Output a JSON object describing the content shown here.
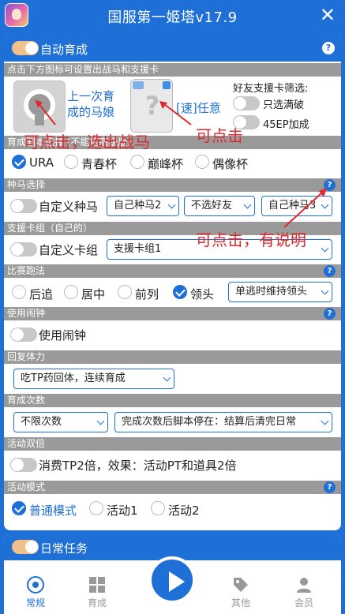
{
  "window": {
    "title": "国服第一姬塔v17.9"
  },
  "auto_train": {
    "label": "自动育成",
    "enabled": true,
    "hint_section": "点击下方图标可设置出战马和支援卡",
    "last_horse_label": "上一次育成的马娘",
    "support_label": "[速]任意",
    "friend_filter_title": "好友支援卡筛选:",
    "friend_options": [
      {
        "label": "只选满破",
        "on": false
      },
      {
        "label": "45EP加成",
        "on": false
      }
    ],
    "scenario_section": "育成剧本选择 (不能用高级版)",
    "scenarios": [
      {
        "label": "URA",
        "selected": true
      },
      {
        "label": "青春杯",
        "selected": false
      },
      {
        "label": "巅峰杯",
        "selected": false
      },
      {
        "label": "偶像杯",
        "selected": false
      }
    ],
    "breed_section": "种马选择",
    "breed_toggle_label": "自定义种马",
    "breed_selects": [
      "自己种马2",
      "不选好友",
      "自己种马3"
    ],
    "support_section": "支援卡组（自己的）",
    "support_toggle_label": "自定义卡组",
    "support_select": "支援卡组1",
    "race_section": "比赛跑法",
    "race_styles": [
      {
        "label": "后追",
        "selected": false
      },
      {
        "label": "居中",
        "selected": false
      },
      {
        "label": "前列",
        "selected": false
      },
      {
        "label": "领头",
        "selected": true
      }
    ],
    "race_select": "单逃时维持领头",
    "alarm_section": "使用闹钟",
    "alarm_label": "使用闹钟",
    "recover_section": "回复体力",
    "recover_select": "吃TP药回体，连续育成",
    "count_section": "育成次数",
    "count_select": "不限次数",
    "finish_select": "完成次数后脚本停在：结算后清完日常",
    "double_section": "活动双倍",
    "double_label": "消费TP2倍，效果：活动PT和道具2倍",
    "mode_section": "活动模式",
    "modes": [
      {
        "label": "普通模式",
        "selected": true
      },
      {
        "label": "活动1",
        "selected": false
      },
      {
        "label": "活动2",
        "selected": false
      }
    ]
  },
  "daily": {
    "label": "日常任务",
    "enabled": true
  },
  "annotations": {
    "select_horse": "可点击，选出战马",
    "clickable": "可点击",
    "clickable_desc": "可点击，有说明"
  },
  "nav": {
    "items": [
      {
        "label": "常规",
        "icon": "chrome-like-icon",
        "active": true
      },
      {
        "label": "育成",
        "icon": "grid-icon",
        "active": false
      },
      {
        "label": "其他",
        "icon": "tag-icon",
        "active": false
      },
      {
        "label": "会员",
        "icon": "user-icon",
        "active": false
      }
    ],
    "play_icon": "play-icon"
  },
  "colors": {
    "primary": "#1e6fd6",
    "annotation": "#e0282e",
    "toggle_on": "#f1c18c",
    "section": "#9a9a9a"
  }
}
